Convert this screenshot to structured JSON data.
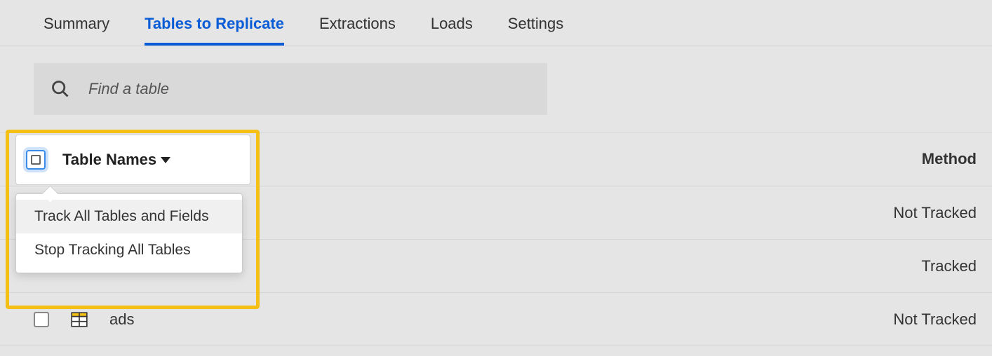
{
  "tabs": {
    "items": [
      {
        "label": "Summary"
      },
      {
        "label": "Tables to Replicate"
      },
      {
        "label": "Extractions"
      },
      {
        "label": "Loads"
      },
      {
        "label": "Settings"
      }
    ],
    "active_index": 1
  },
  "search": {
    "placeholder": "Find a table"
  },
  "header": {
    "table_names_label": "Table Names",
    "method_label": "Method"
  },
  "dropdown": {
    "items": [
      {
        "label": "Track All Tables and Fields"
      },
      {
        "label": "Stop Tracking All Tables"
      }
    ],
    "hover_index": 0
  },
  "rows": [
    {
      "name": "",
      "status": "Not Tracked",
      "visible_content": false
    },
    {
      "name": "",
      "status": "Tracked",
      "visible_content": false
    },
    {
      "name": "ads",
      "status": "Not Tracked",
      "visible_content": true
    }
  ]
}
